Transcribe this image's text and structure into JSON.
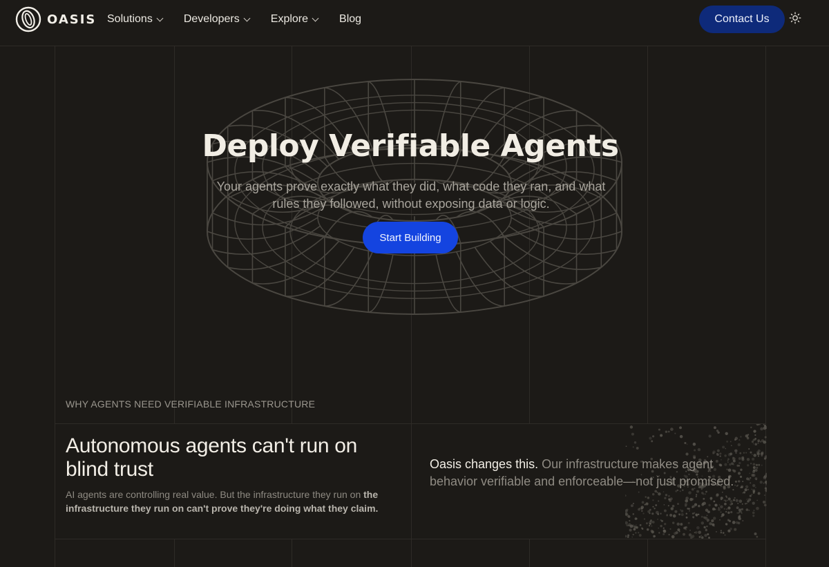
{
  "brand": {
    "name": "OASIS"
  },
  "nav": {
    "items": [
      {
        "label": "Solutions",
        "has_dropdown": true
      },
      {
        "label": "Developers",
        "has_dropdown": true
      },
      {
        "label": "Explore",
        "has_dropdown": true
      },
      {
        "label": "Blog",
        "has_dropdown": false
      }
    ],
    "contact_label": "Contact Us",
    "theme_icon": "sun-icon"
  },
  "hero": {
    "title": "Deploy Verifiable Agents",
    "subtitle": "Your agents prove exactly what they did, what code they ran, and what rules they followed, without exposing data or logic.",
    "cta_label": "Start Building"
  },
  "section": {
    "eyebrow": "WHY AGENTS NEED VERIFIABLE INFRASTRUCTURE",
    "title": "Autonomous agents can't run on blind trust",
    "body_plain": "AI agents are controlling real value. But the infrastructure they run on ",
    "body_bold": "the infrastructure they run on can't prove they're doing what they claim.",
    "changes_lead": "Oasis changes this.",
    "changes_rest": " Our infrastructure makes agent behavior verifiable and enforceable—not just promised."
  },
  "colors": {
    "background": "#1c1a17",
    "contact_button": "#0e2a7a",
    "cta_button": "#1444e0",
    "grid_line": "#2e2b27"
  }
}
